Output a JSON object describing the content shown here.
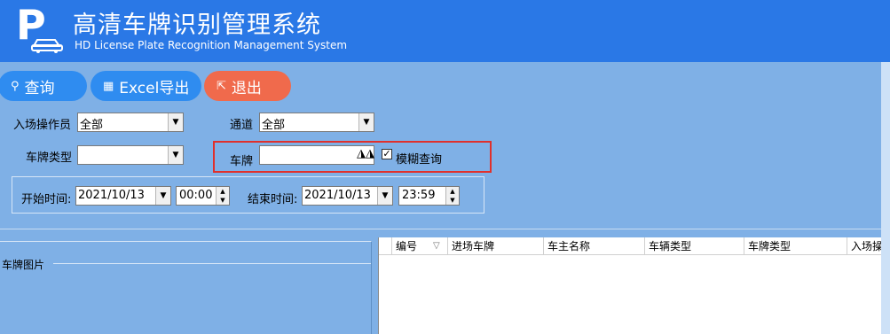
{
  "header": {
    "title": "高清车牌识别管理系统",
    "subtitle": "HD License Plate Recognition Management System",
    "logo_letter": "P",
    "color": "#2a78e6"
  },
  "toolbar": {
    "query_label": "查询",
    "excel_label": "Excel导出",
    "exit_label": "退出",
    "query_color": "#2f8cf0",
    "exit_color": "#f06a4c"
  },
  "form": {
    "operator_label": "入场操作员",
    "operator_value": "全部",
    "channel_label": "通道",
    "channel_value": "全部",
    "plate_type_label": "车牌类型",
    "plate_type_value": "",
    "plate_label": "车牌",
    "plate_value": "",
    "fuzzy_label": "模糊查询",
    "fuzzy_checked": true,
    "start_label": "开始时间:",
    "start_date": "2021/10/13",
    "start_time": "00:00",
    "end_label": "结束时间:",
    "end_date": "2021/10/13",
    "end_time": "23:59"
  },
  "photo_panel": {
    "label": "车牌图片"
  },
  "grid": {
    "columns": [
      "编号",
      "进场车牌",
      "车主名称",
      "车辆类型",
      "车牌类型",
      "入场操作"
    ]
  }
}
